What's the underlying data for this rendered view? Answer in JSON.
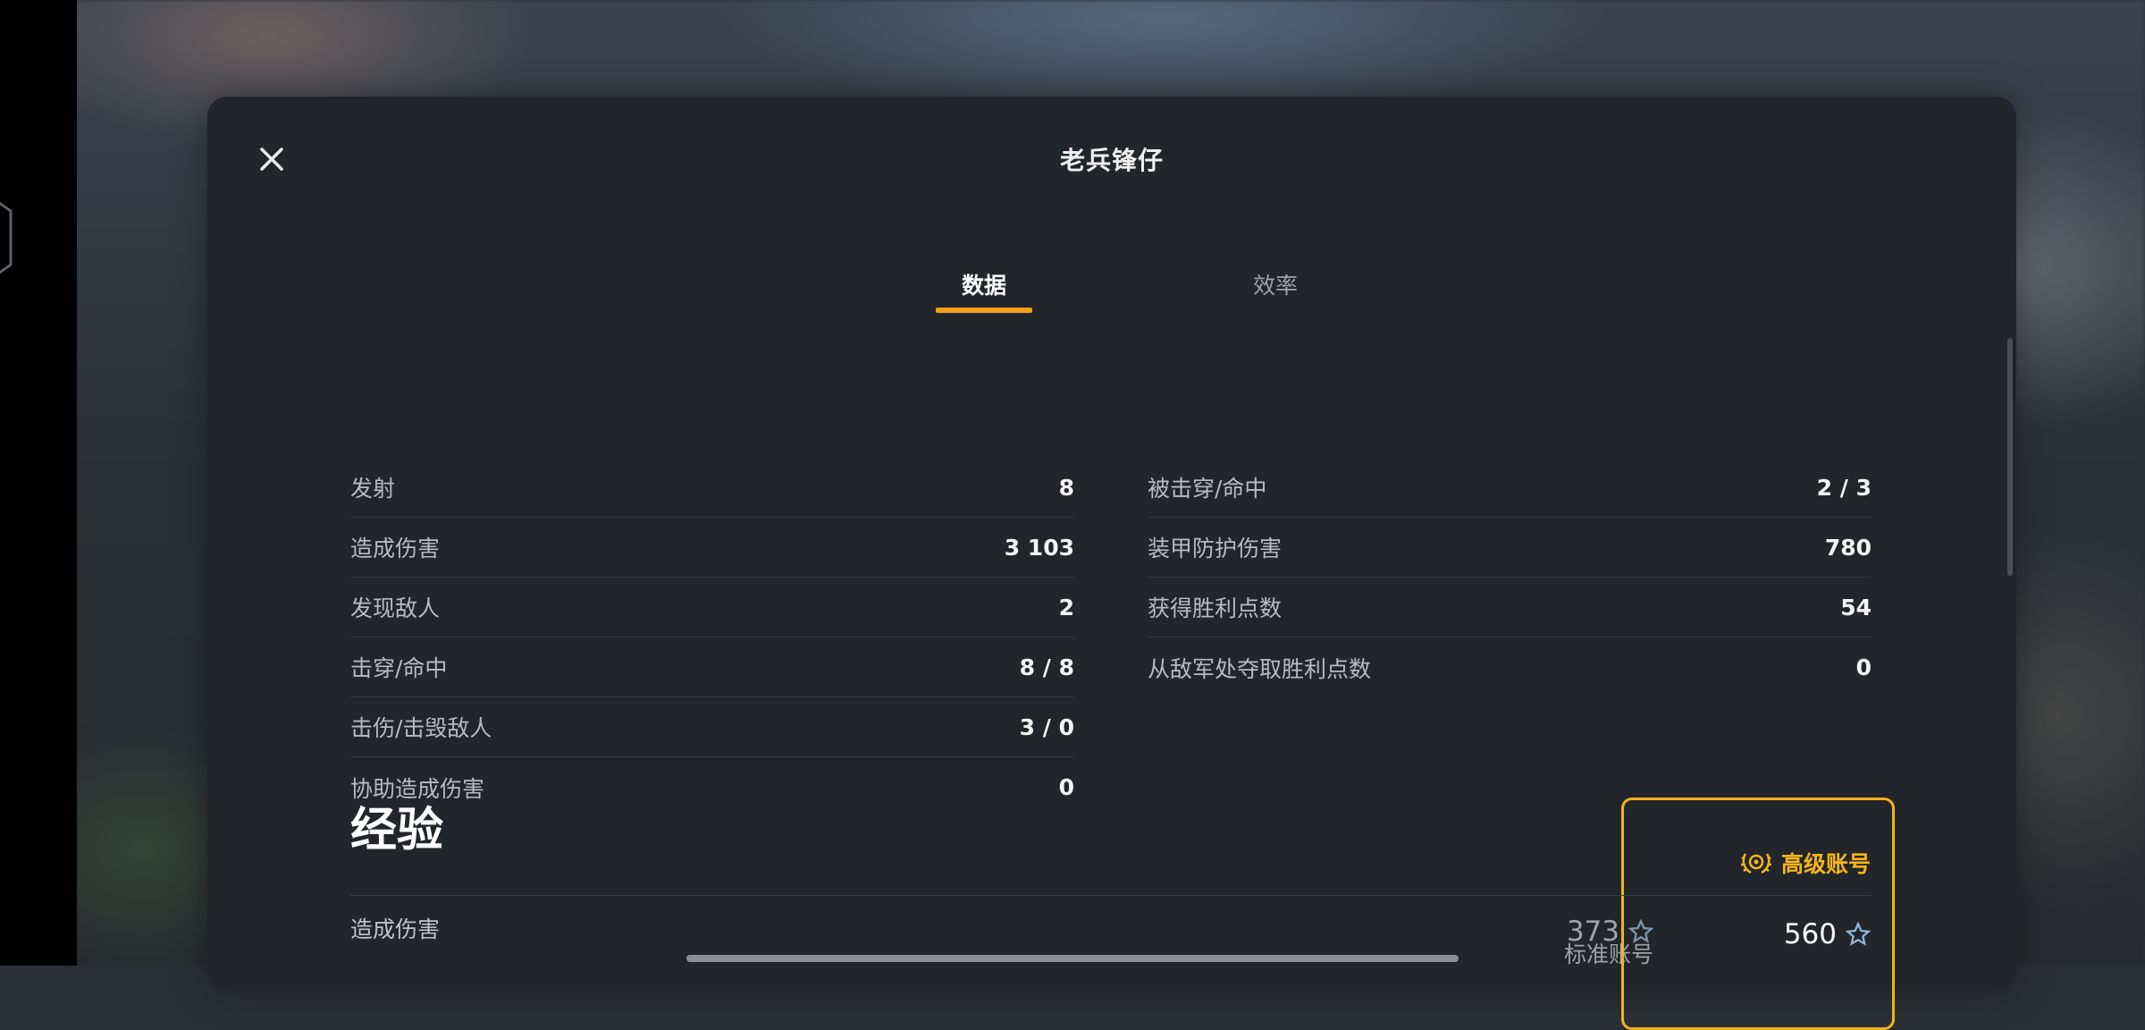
{
  "dialog": {
    "title": "老兵锋仔"
  },
  "tabs": [
    {
      "label": "数据",
      "active": true
    },
    {
      "label": "效率",
      "active": false
    }
  ],
  "stats_left": [
    {
      "label": "发射",
      "value": "8"
    },
    {
      "label": "造成伤害",
      "value": "3 103"
    },
    {
      "label": "发现敌人",
      "value": "2"
    },
    {
      "label": "击穿/命中",
      "value": "8 / 8"
    },
    {
      "label": "击伤/击毁敌人",
      "value": "3 / 0"
    },
    {
      "label": "协助造成伤害",
      "value": "0"
    }
  ],
  "stats_right": [
    {
      "label": "被击穿/命中",
      "value": "2 / 3"
    },
    {
      "label": "装甲防护伤害",
      "value": "780"
    },
    {
      "label": "获得胜利点数",
      "value": "54"
    },
    {
      "label": "从敌军处夺取胜利点数",
      "value": "0"
    }
  ],
  "experience": {
    "title": "经验",
    "standard_header": "标准账号",
    "premium_header": "高级账号",
    "rows": [
      {
        "label": "造成伤害",
        "standard": "373",
        "premium": "560"
      }
    ]
  },
  "colors": {
    "accent": "#f3a01c",
    "premium": "#f5b51c",
    "panel": "#22262a"
  },
  "icons": {
    "close": "close-icon",
    "star": "star-icon",
    "premium": "premium-laurel-icon"
  }
}
